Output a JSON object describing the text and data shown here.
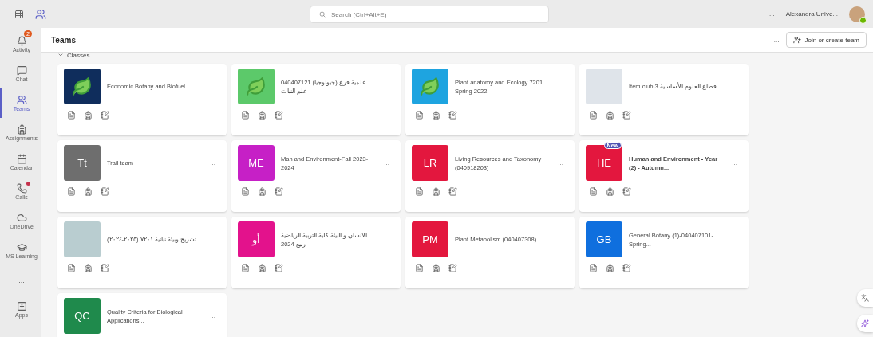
{
  "top_bar": {
    "search": {
      "placeholder": "Search (Ctrl+Alt+E)"
    },
    "more": "...",
    "user_name": "Alexandra Unive..."
  },
  "rail": [
    {
      "label": "Activity",
      "selected": false,
      "badge": "2",
      "alert": false
    },
    {
      "label": "Chat",
      "selected": false,
      "alert": false
    },
    {
      "label": "Teams",
      "selected": true,
      "alert": false
    },
    {
      "label": "Assignments",
      "selected": false,
      "alert": false
    },
    {
      "label": "Calendar",
      "selected": false,
      "alert": false
    },
    {
      "label": "Calls",
      "selected": false,
      "alert": true
    },
    {
      "label": "OneDrive",
      "selected": false,
      "alert": false
    },
    {
      "label": "MS Learning",
      "selected": false,
      "alert": false
    },
    {
      "label": "...",
      "selected": false,
      "alert": false
    },
    {
      "label": "Apps",
      "selected": false,
      "alert": false
    }
  ],
  "header": {
    "title": "Teams",
    "more": "...",
    "join_button": "Join or create team"
  },
  "section": {
    "label": "Classes",
    "expanded": true
  },
  "teams": [
    {
      "kind": "artwork",
      "color": "#0f2d5c",
      "title": "Economic Botany and Biofuel",
      "unread": false,
      "more": "..."
    },
    {
      "kind": "artwork",
      "color": "#5cc96a",
      "title": "040407121 (جيولوجيا) علمية فرع علم النبات",
      "unread": false,
      "more": "..."
    },
    {
      "kind": "artwork",
      "color": "#1ea4e0",
      "title": "Plant anatomy and Ecology 7201 Spring 2022",
      "unread": false,
      "more": "..."
    },
    {
      "kind": "photo",
      "color": "#dfe4ea",
      "title": "Item club 3 قطاع العلوم الأساسية",
      "unread": false,
      "more": "..."
    },
    {
      "kind": "initials",
      "color": "#6e6e6e",
      "initials": "Tt",
      "title": "Trail team",
      "unread": false,
      "more": "..."
    },
    {
      "kind": "initials",
      "color": "#c620c6",
      "initials": "ME",
      "title": "Man and Environment-Fall 2023-2024",
      "unread": false,
      "more": "..."
    },
    {
      "kind": "initials",
      "color": "#e3173e",
      "initials": "LR",
      "title": "Living Resources and Taxonomy (040918203)",
      "unread": false,
      "more": "..."
    },
    {
      "kind": "initials",
      "color": "#e3173e",
      "initials": "HE",
      "badge": "New",
      "title": "Human and Environment - Year (2) - Autumn...",
      "unread": true,
      "more": "..."
    },
    {
      "kind": "photo",
      "color": "#b9cdd0",
      "title": "تشريح وبيئة نباتية ٧٢٠١ (٢٠٢٥-٢٠٢٤)",
      "unread": false,
      "more": "..."
    },
    {
      "kind": "initials",
      "color": "#e3128c",
      "initials": "أو",
      "title": "الانسان و البيئة كلية التربية الرياضية ربيع 2024",
      "unread": false,
      "more": "..."
    },
    {
      "kind": "initials",
      "color": "#e3173e",
      "initials": "PM",
      "title": "Plant Metabolism (040407308)",
      "unread": false,
      "more": "..."
    },
    {
      "kind": "initials",
      "color": "#0f6fde",
      "initials": "GB",
      "title": "General Botany (1)-040407101-Spring...",
      "unread": false,
      "more": "..."
    },
    {
      "kind": "initials",
      "color": "#1f8a4c",
      "initials": "QC",
      "title": "Quality Criteria for Biological Applications...",
      "unread": false,
      "more": "..."
    }
  ]
}
